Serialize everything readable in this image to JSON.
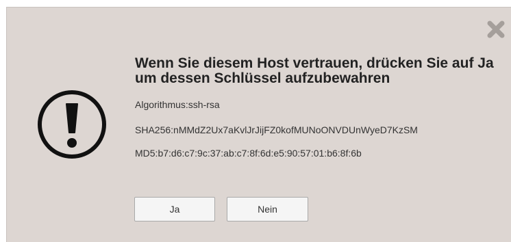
{
  "dialog": {
    "title": "Wenn Sie diesem Host vertrauen, drücken Sie auf Ja um dessen Schlüssel aufzubewahren",
    "algorithm": "Algorithmus:ssh-rsa",
    "sha256": "SHA256:nMMdZ2Ux7aKvlJrJijFZ0kofMUNoONVDUnWyeD7KzSM",
    "md5": "MD5:b7:d6:c7:9c:37:ab:c7:8f:6d:e5:90:57:01:b6:8f:6b",
    "buttons": {
      "yes_label": "Ja",
      "no_label": "Nein"
    },
    "icons": {
      "warning": "warning-icon",
      "close": "close-icon"
    },
    "colors": {
      "background": "#ddd6d2",
      "close_icon": "#a59f9b",
      "warning_icon": "#111111"
    }
  }
}
